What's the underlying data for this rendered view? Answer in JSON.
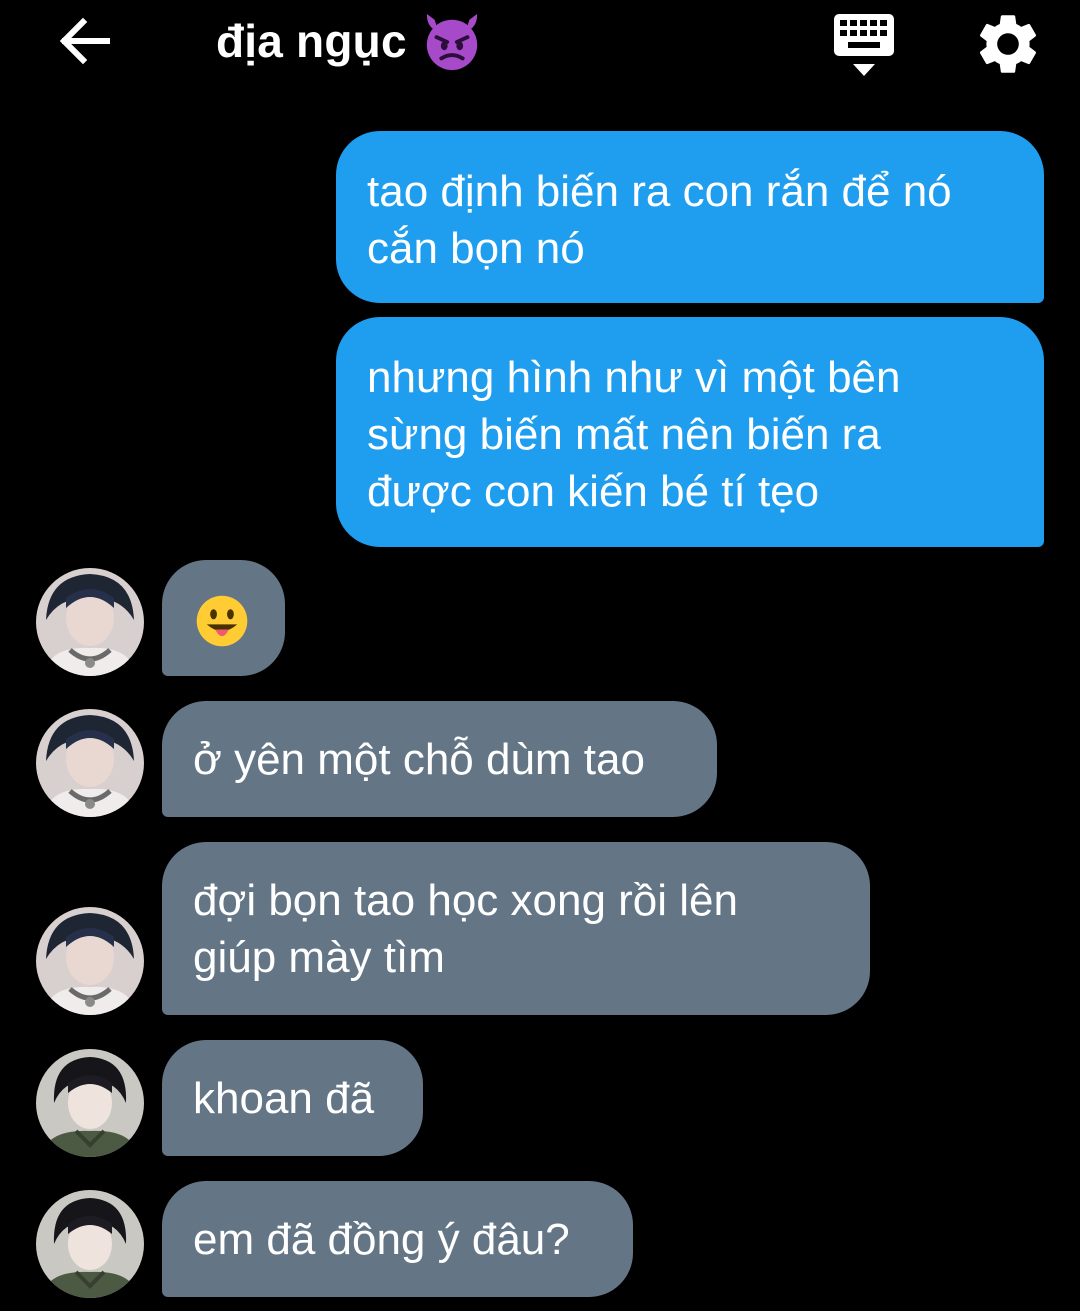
{
  "header": {
    "back_icon": "arrow-left-icon",
    "title": "địa ngục",
    "title_emoji": "smiling-face-with-horns-emoji",
    "keyboard_icon": "keyboard-hide-icon",
    "settings_icon": "gear-icon"
  },
  "messages": {
    "m1": {
      "text": "tao định biến ra con rắn để nó\ncắn bọn nó",
      "direction": "outgoing"
    },
    "m2": {
      "text": "nhưng hình như vì một bên\nsừng biến mất nên biến ra\nđược con kiến bé tí tẹo",
      "direction": "outgoing"
    },
    "m3": {
      "emoji": "grinning-face-with-tongue-emoji",
      "direction": "incoming"
    },
    "m4": {
      "text": "ở yên một chỗ dùm tao",
      "direction": "incoming"
    },
    "m5": {
      "text": "đợi bọn tao học xong rồi lên\ngiúp mày tìm",
      "direction": "incoming"
    },
    "m6": {
      "text": "khoan đã",
      "direction": "incoming"
    },
    "m7": {
      "text": "em đã đồng ý đâu?",
      "direction": "incoming"
    }
  },
  "colors": {
    "background": "#000000",
    "outgoing_bubble": "#1f9ef0",
    "incoming_bubble": "#647586",
    "text": "#ffffff"
  }
}
